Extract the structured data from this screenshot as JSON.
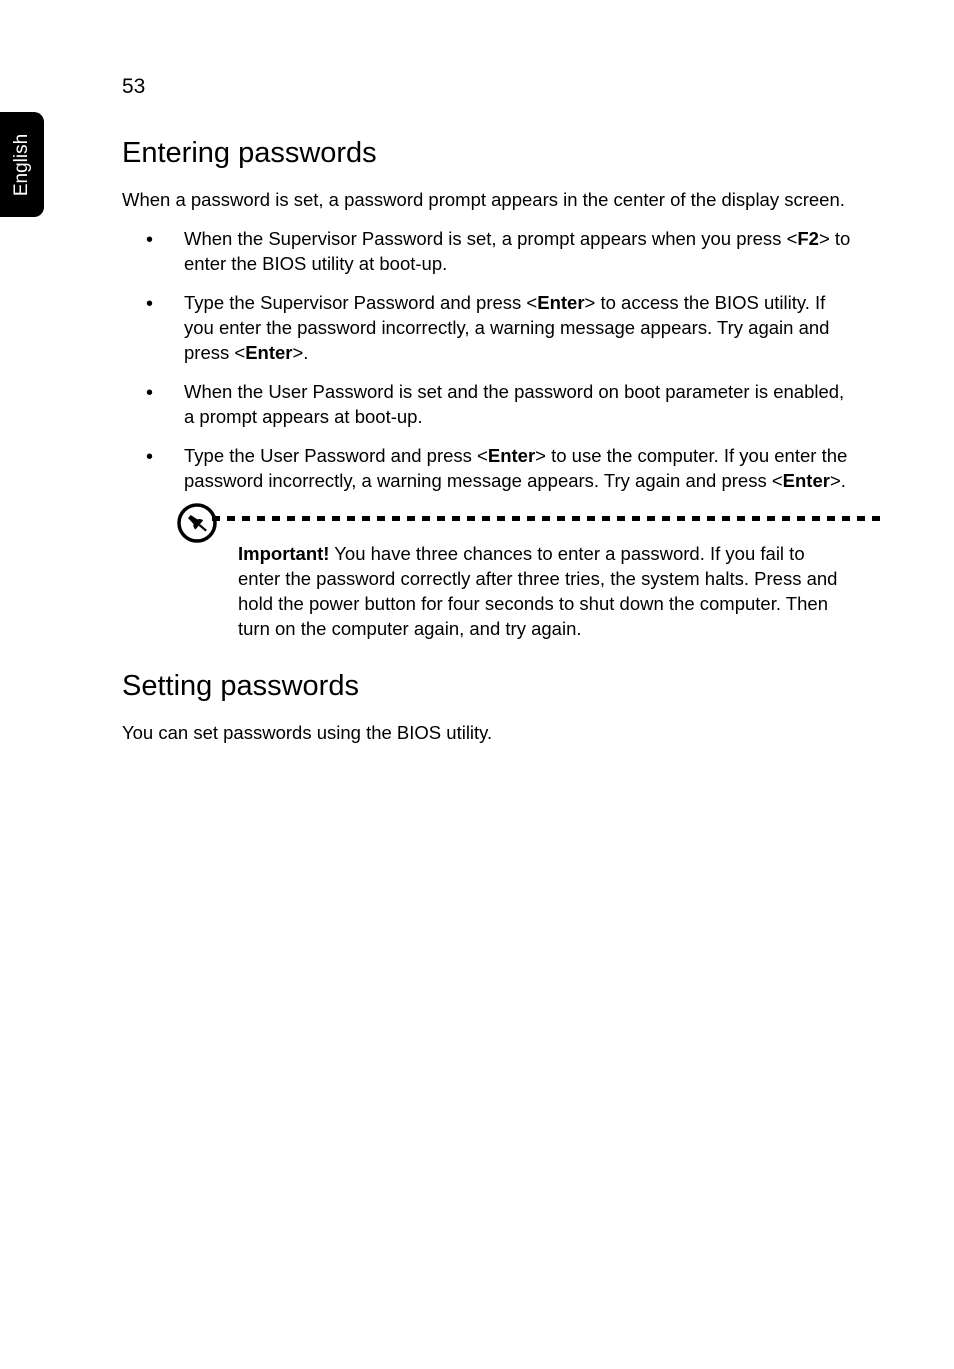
{
  "sideTab": "English",
  "pageNumber": "53",
  "heading1": "Entering passwords",
  "intro": "When a password is set, a password prompt appears in the center of the display screen.",
  "bullets": [
    {
      "pre": "When the Supervisor Password is set, a prompt appears when you press <",
      "b1": "F2",
      "post": "> to enter the BIOS utility at boot-up."
    },
    {
      "pre": "Type the Supervisor Password and press <",
      "b1": "Enter",
      "mid": "> to access the BIOS utility. If you enter the password incorrectly, a warning message appears. Try again and press <",
      "b2": "Enter",
      "post": ">."
    },
    {
      "pre": "When the User Password is set and the password on boot parameter is enabled, a prompt appears at boot-up.",
      "b1": "",
      "post": ""
    },
    {
      "pre": "Type the User Password and press <",
      "b1": "Enter",
      "mid": "> to use the computer. If you enter the password incorrectly, a warning message appears. Try again and press <",
      "b2": "Enter",
      "post": ">."
    }
  ],
  "noteLabel": "Important!",
  "noteText": " You have three chances to enter a password. If you fail to enter the password correctly after three tries, the system halts. Press and hold the power button for four seconds to shut down the computer. Then turn on the computer again, and try again.",
  "heading2": "Setting passwords",
  "settingText": "You can set passwords using the BIOS utility."
}
